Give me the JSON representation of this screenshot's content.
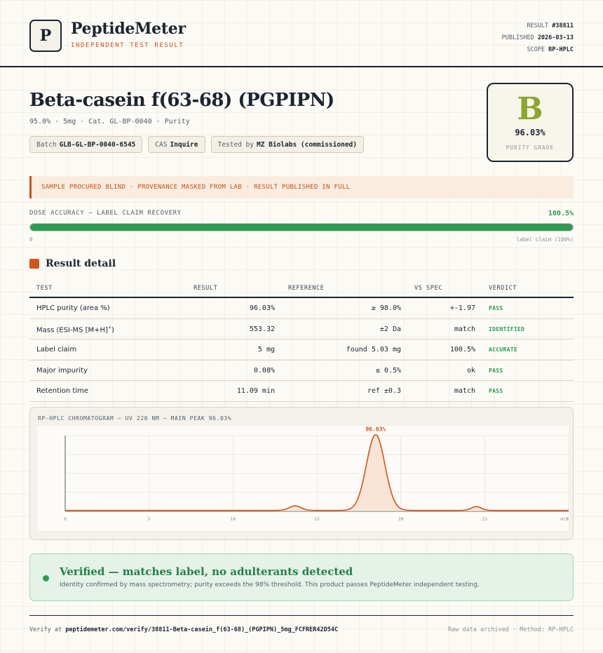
{
  "brand": {
    "logo_letter": "P",
    "name": "PeptideMeter",
    "tagline": "INDEPENDENT TEST RESULT"
  },
  "meta": {
    "result_label": "RESULT",
    "result_value": "#38811",
    "published_label": "PUBLISHED",
    "published_value": "2026-03-13",
    "scope_label": "SCOPE",
    "scope_value": "RP-HPLC"
  },
  "product": {
    "title": "Beta-casein f(63-68) (PGPIPN)",
    "subtitle": "95.0% · 5mg · Cat. GL-BP-0040 · Purity",
    "chips": [
      {
        "label": "Batch",
        "value": "GLB-GL-BP-0040-6545"
      },
      {
        "label": "CAS",
        "value": "Inquire"
      },
      {
        "label": "Tested by",
        "value": "MZ Biolabs (commissioned)"
      }
    ]
  },
  "grade": {
    "letter": "B",
    "value": "96.03%",
    "label": "PURITY GRADE",
    "color": "#8ea52b"
  },
  "notice": "SAMPLE PROCURED BLIND · PROVENANCE MASKED FROM LAB · RESULT PUBLISHED IN FULL",
  "dose": {
    "label": "DOSE ACCURACY — LABEL CLAIM RECOVERY",
    "percent_text": "100.5%",
    "fill_fraction": 1.0,
    "min_label": "0",
    "max_label": "label claim (100%)",
    "color": "#2e9a55"
  },
  "section_title": "Result detail",
  "table": {
    "headers": [
      "TEST",
      "RESULT",
      "REFERENCE",
      "VS SPEC",
      "VERDICT"
    ],
    "rows": [
      {
        "test": "HPLC purity (area %)",
        "test_sup": "",
        "result": "96.03%",
        "reference": "≥ 98.0%",
        "vs_spec": "+-1.97",
        "verdict": "PASS"
      },
      {
        "test": "Mass (ESI-MS [M+H]",
        "test_sup": "+",
        "test_after": ")",
        "result": "553.32",
        "reference": "±2 Da",
        "vs_spec": "match",
        "verdict": "IDENTIFIED"
      },
      {
        "test": "Label claim",
        "test_sup": "",
        "result": "5 mg",
        "reference": "found 5.03 mg",
        "vs_spec": "100.5%",
        "verdict": "ACCURATE"
      },
      {
        "test": "Major impurity",
        "test_sup": "",
        "result": "0.08%",
        "reference": "≤ 0.5%",
        "vs_spec": "ok",
        "verdict": "PASS"
      },
      {
        "test": "Retention time",
        "test_sup": "",
        "result": "11.09 min",
        "reference": "ref ±0.3",
        "vs_spec": "match",
        "verdict": "PASS"
      }
    ]
  },
  "chart_data": {
    "type": "line",
    "title": "RP-HPLC CHROMATOGRAM — UV 220 NM — MAIN PEAK 96.03%",
    "x_ticks": [
      0,
      5,
      10,
      15,
      20,
      25,
      30
    ],
    "x_tick_labels": [
      "0",
      "5",
      "10",
      "15",
      "20",
      "25",
      "30"
    ],
    "x_unit_label": "min",
    "xlim": [
      0,
      30
    ],
    "ylim": [
      0,
      1
    ],
    "peaks": [
      {
        "center": 13.7,
        "height": 0.06,
        "width": 0.35
      },
      {
        "center": 18.5,
        "height": 1.0,
        "width": 0.55,
        "label": "96.03%"
      },
      {
        "center": 24.5,
        "height": 0.05,
        "width": 0.3
      }
    ],
    "line_color": "#d2541a",
    "fill_color": "#f7dcc8"
  },
  "verified": {
    "title": "Verified — matches label, no adulterants detected",
    "description": "Identity confirmed by mass spectrometry; purity exceeds the 98% threshold. This product passes PeptideMeter independent testing."
  },
  "footer": {
    "verify_prefix": "Verify at",
    "verify_url": "peptidemeter.com/verify/38811-Beta-casein_f(63-68)_(PGPIPN)_5mg_FCFRER42D54C",
    "right_text": "Raw data archived · Method: RP-HPLC"
  }
}
